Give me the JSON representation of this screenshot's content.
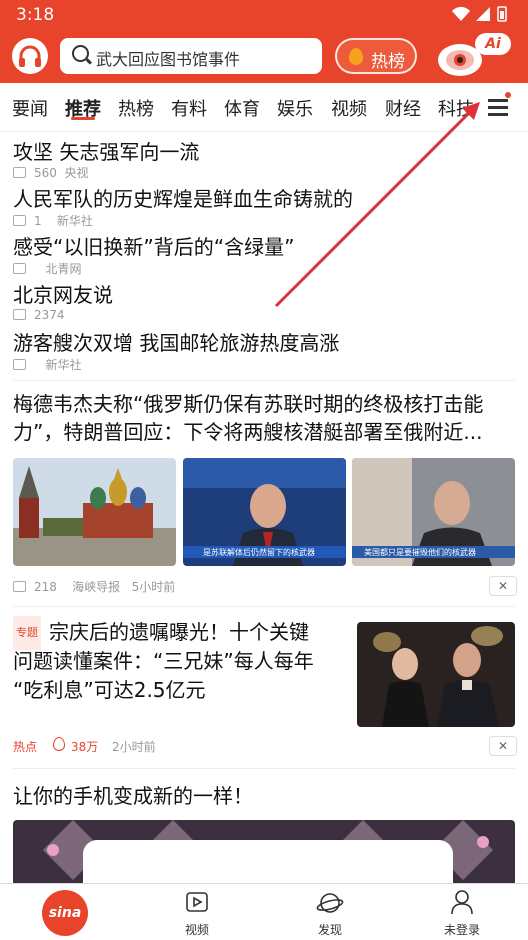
{
  "status_bar": {
    "time": "3:18"
  },
  "header": {
    "search_placeholder": "武大回应图书馆事件",
    "hot_label": "热榜",
    "ai_label": "Ai"
  },
  "nav": {
    "tabs": [
      "要闻",
      "推荐",
      "热榜",
      "有料",
      "体育",
      "娱乐",
      "视频",
      "财经",
      "科技"
    ],
    "active": "推荐"
  },
  "headlines": [
    {
      "title": "攻坚 矢志强军向一流",
      "comments": "560",
      "source": "央视"
    },
    {
      "title": "人民军队的历史辉煌是鲜血生命铸就的",
      "comments": "1",
      "source": "新华社"
    },
    {
      "title": "感受“以旧换新”背后的“含绿量”",
      "comments": "",
      "source": "北青网"
    },
    {
      "title": "北京网友说",
      "comments": "2374",
      "source": ""
    },
    {
      "title": "游客艘次双增 我国邮轮旅游热度高涨",
      "comments": "",
      "source": "新华社"
    }
  ],
  "article1": {
    "title_line1": "梅德韦杰夫称“俄罗斯仍保有苏联时期的终极核打击能",
    "title_line2": "力”，特朗普回应：下令将两艘核潜艇部署至俄附近...",
    "image_captions": [
      "",
      "是苏联解体后仍然留下的核武器",
      "美国都只是要摧毁他们的核武器"
    ],
    "comments": "218",
    "source": "海峡导报",
    "time": "5小时前",
    "close": "✕"
  },
  "article2": {
    "tag": "专题",
    "title_line1": "宗庆后的遗嘱曝光！十个关键",
    "title_line2": "问题读懂案件：“三兄妹”每人每年",
    "title_line3": "“吃利息”可达2.5亿元",
    "hot_label": "热点",
    "heat": "38万",
    "time": "2小时前",
    "close": "✕"
  },
  "article3": {
    "title": "让你的手机变成新的一样！"
  },
  "bottom_nav": {
    "home_logo": "sina",
    "video": "视频",
    "discover": "发现",
    "login": "未登录"
  },
  "colors": {
    "accent": "#e8432b",
    "annotation_arrow": "#e0303a"
  }
}
